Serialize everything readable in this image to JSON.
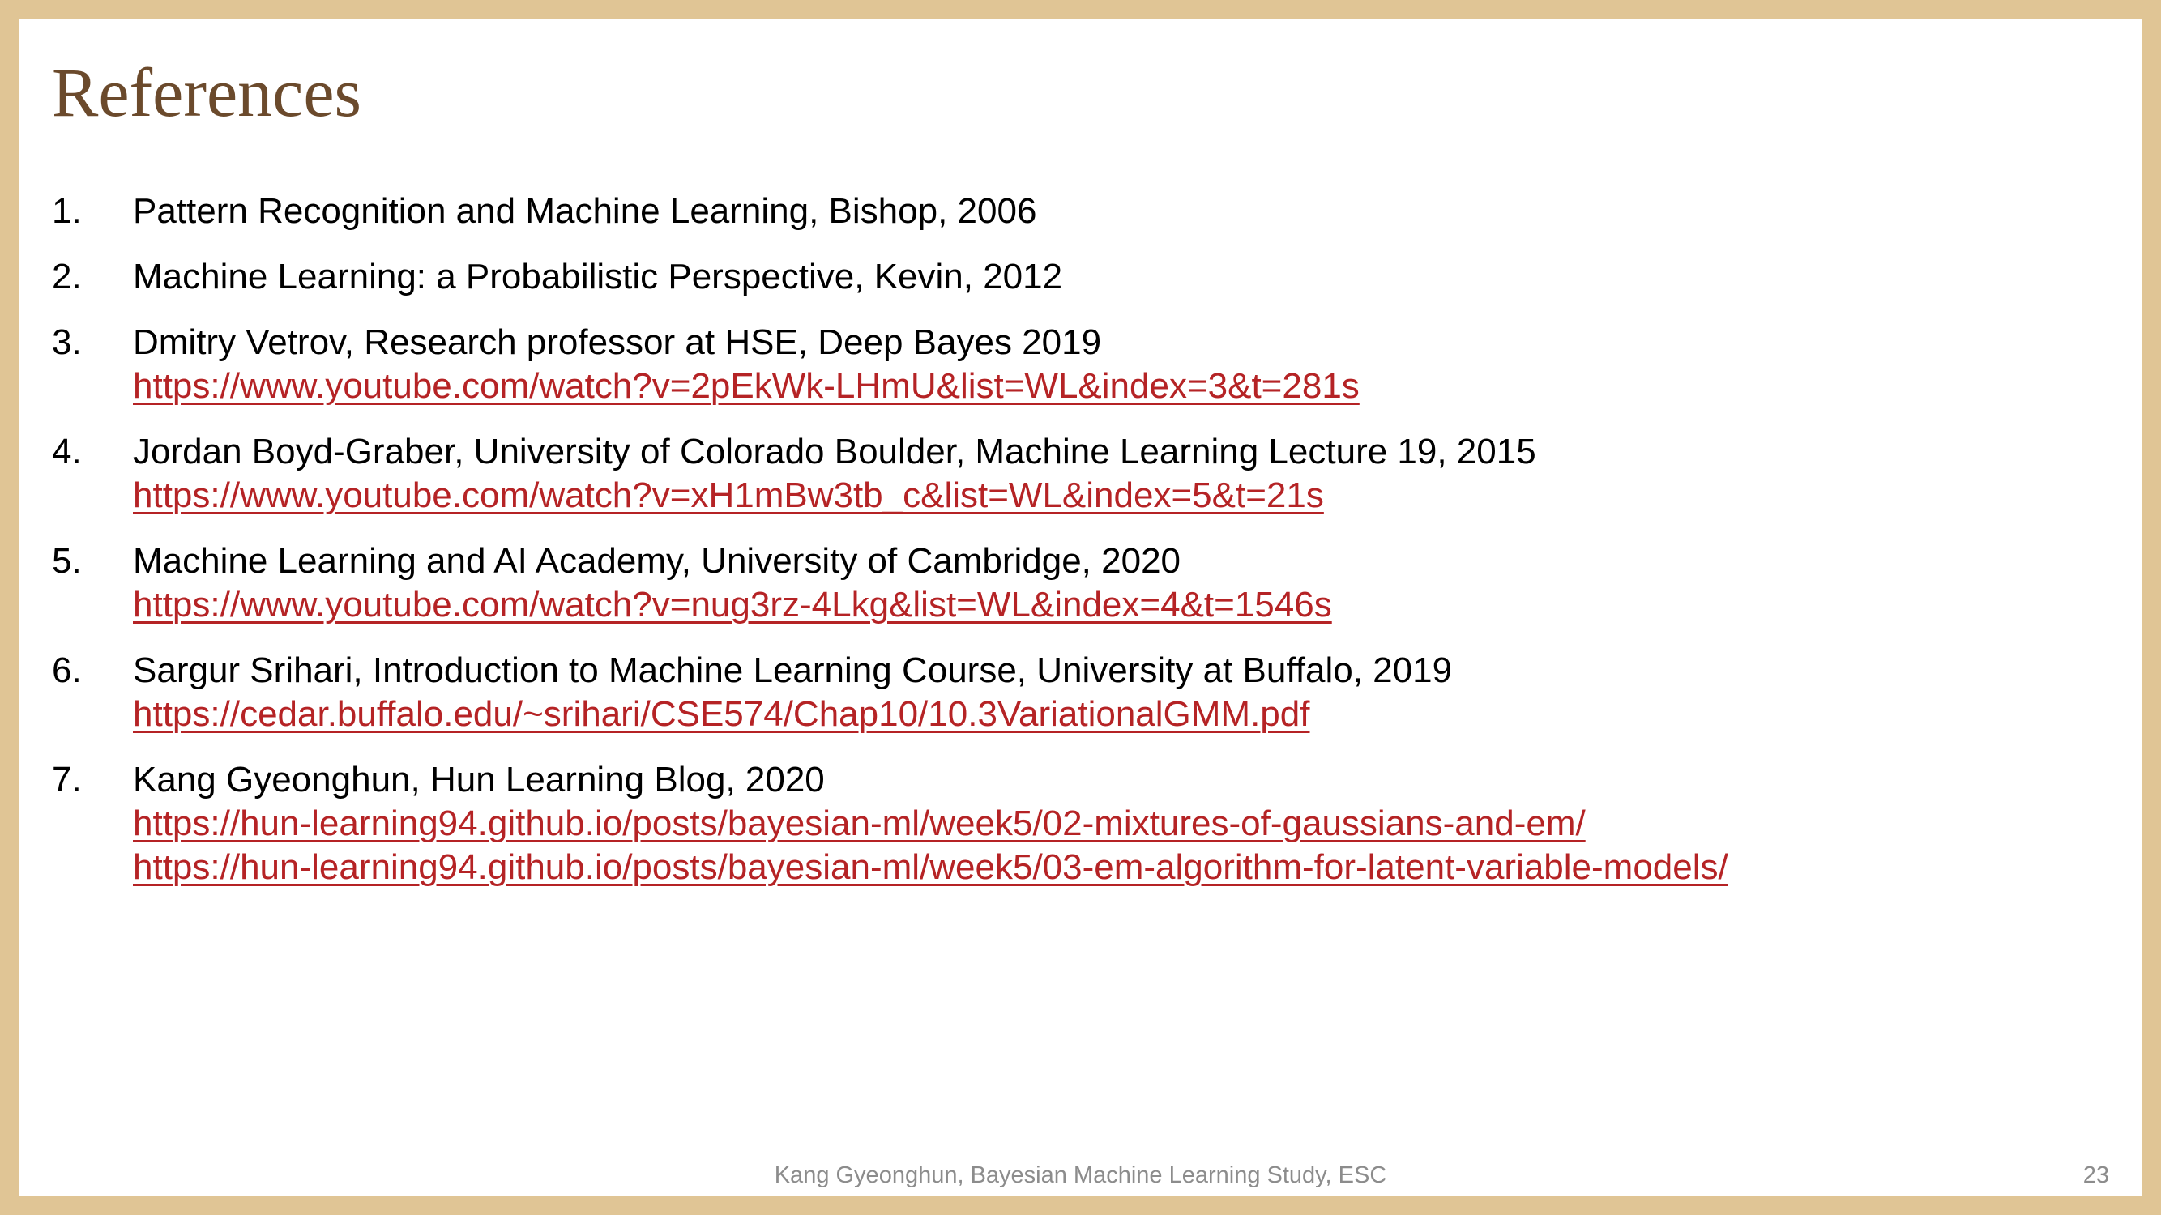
{
  "slide": {
    "title": "References",
    "footer": "Kang Gyeonghun, Bayesian Machine Learning Study, ESC",
    "page_number": "23"
  },
  "colors": {
    "border": "#e0c595",
    "title": "#6b4a2c",
    "link": "#b52325",
    "footer": "#8c8c8c"
  },
  "references": [
    {
      "number": "1.",
      "text": "Pattern Recognition and Machine Learning, Bishop, 2006",
      "links": []
    },
    {
      "number": "2.",
      "text": "Machine Learning: a Probabilistic Perspective, Kevin, 2012",
      "links": []
    },
    {
      "number": "3.",
      "text": "Dmitry Vetrov, Research professor at HSE, Deep Bayes 2019",
      "links": [
        "https://www.youtube.com/watch?v=2pEkWk-LHmU&list=WL&index=3&t=281s"
      ]
    },
    {
      "number": "4.",
      "text": "Jordan Boyd-Graber, University of Colorado Boulder, Machine Learning Lecture 19, 2015",
      "links": [
        "https://www.youtube.com/watch?v=xH1mBw3tb_c&list=WL&index=5&t=21s"
      ]
    },
    {
      "number": "5.",
      "text": "Machine Learning and AI Academy, University of Cambridge, 2020",
      "links": [
        "https://www.youtube.com/watch?v=nug3rz-4Lkg&list=WL&index=4&t=1546s"
      ]
    },
    {
      "number": "6.",
      "text": "Sargur Srihari, Introduction to Machine Learning Course, University at Buffalo, 2019",
      "links": [
        "https://cedar.buffalo.edu/~srihari/CSE574/Chap10/10.3VariationalGMM.pdf"
      ]
    },
    {
      "number": "7.",
      "text": "Kang Gyeonghun, Hun Learning Blog, 2020",
      "links": [
        "https://hun-learning94.github.io/posts/bayesian-ml/week5/02-mixtures-of-gaussians-and-em/",
        "https://hun-learning94.github.io/posts/bayesian-ml/week5/03-em-algorithm-for-latent-variable-models/"
      ]
    }
  ]
}
